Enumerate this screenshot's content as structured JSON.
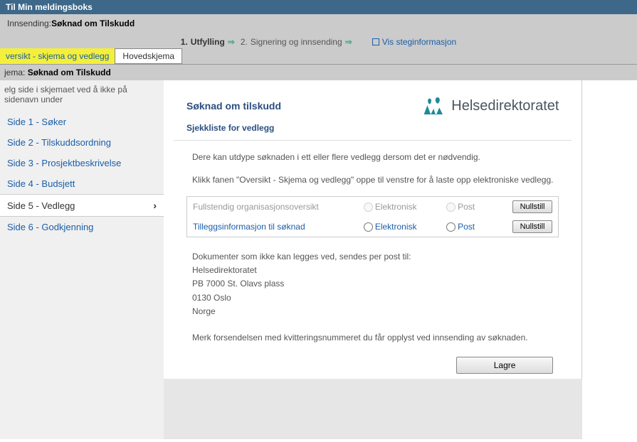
{
  "header": {
    "title": "Til Min meldingsboks"
  },
  "innsending": {
    "label": "Innsending:",
    "value": "Søknad om Tilskudd"
  },
  "steps": {
    "step1_num": "1.",
    "step1_label": "Utfylling",
    "step2_num": "2.",
    "step2_label": "Signering og innsending",
    "vis_steg": "Vis steginformasjon"
  },
  "tabs": {
    "oversikt": "versikt - skjema og vedlegg",
    "hovedskjema": "Hovedskjema"
  },
  "sidebar": {
    "jema_label": "jema:",
    "jema_value": "Søknad om Tilskudd",
    "intro": "elg side i skjemaet ved å ikke på sidenavn under",
    "items": [
      {
        "label": "Side 1 - Søker"
      },
      {
        "label": "Side 2 - Tilskuddsordning"
      },
      {
        "label": "Side 3 - Prosjektbeskrivelse"
      },
      {
        "label": "Side 4 - Budsjett"
      },
      {
        "label": "Side 5 - Vedlegg"
      },
      {
        "label": "Side 6 - Godkjenning"
      }
    ]
  },
  "main": {
    "title": "Søknad om tilskudd",
    "section": "Sjekkliste for vedlegg",
    "text1": "Dere kan utdype søknaden i ett eller flere vedlegg dersom det er nødvendig.",
    "text2": "Klikk fanen \"Oversikt - Skjema og vedlegg\" oppe til venstre for å laste opp elektroniske vedlegg.",
    "brand": "Helsedirektoratet",
    "attachments": [
      {
        "name": "Fullstendig organisasjonsoversikt",
        "elektronisk": "Elektronisk",
        "post": "Post",
        "btn": "Nullstill",
        "disabled": true
      },
      {
        "name": "Tilleggsinformasjon til søknad",
        "elektronisk": "Elektronisk",
        "post": "Post",
        "btn": "Nullstill",
        "disabled": false
      }
    ],
    "address_intro": "Dokumenter som ikke kan legges ved, sendes per post til:",
    "address": {
      "line1": "Helsedirektoratet",
      "line2": "PB 7000 St. Olavs plass",
      "line3": "0130 Oslo",
      "line4": "Norge"
    },
    "merk": "Merk forsendelsen med kvitteringsnummeret du får opplyst ved innsending av søknaden.",
    "lagre": "Lagre"
  }
}
